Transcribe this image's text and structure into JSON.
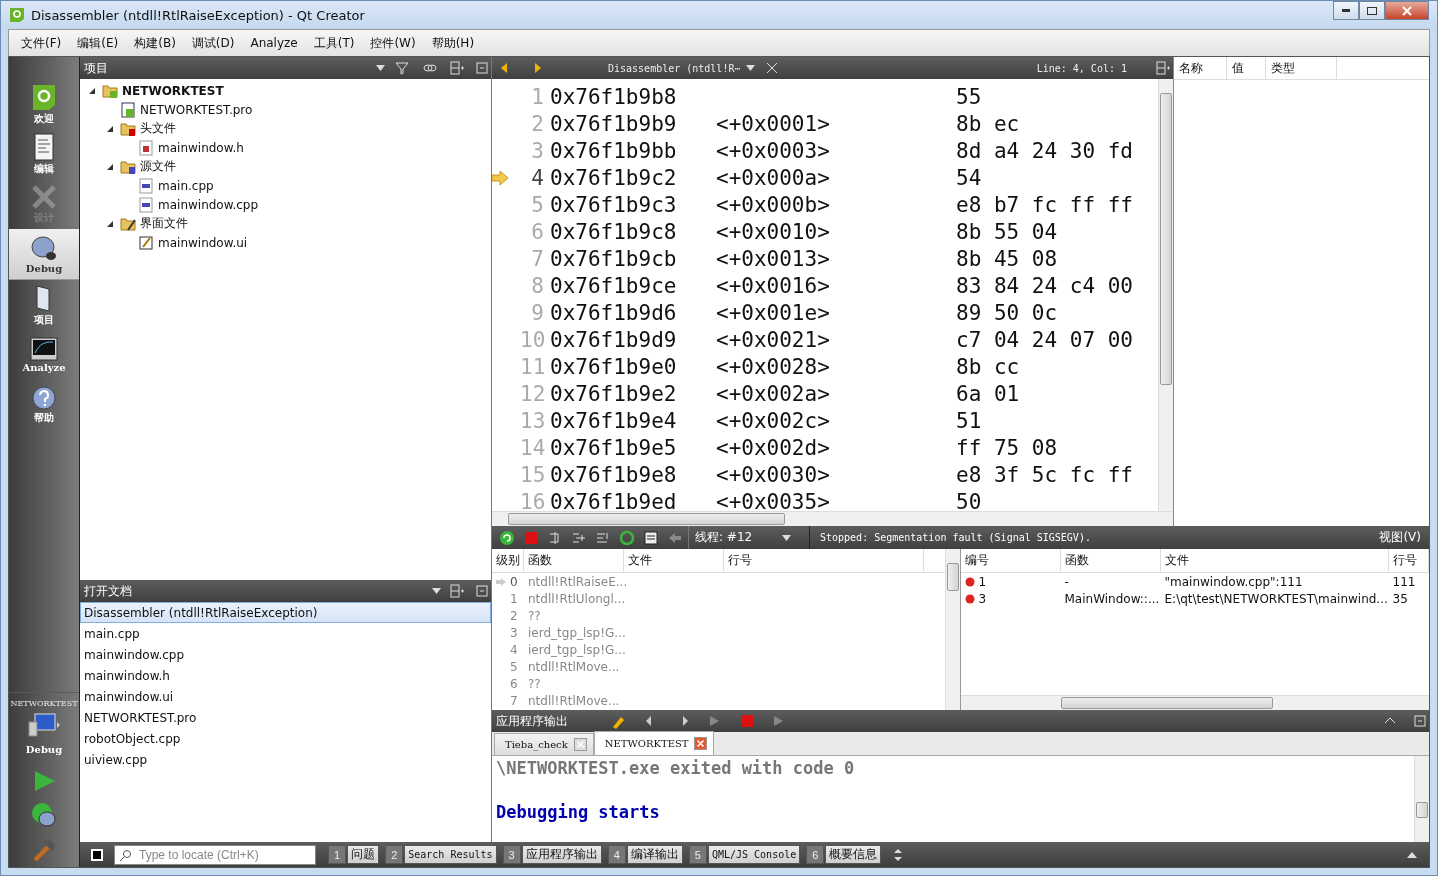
{
  "window": {
    "title": "Disassembler (ntdll!RtlRaiseException) - Qt Creator"
  },
  "menu": [
    "文件(F)",
    "编辑(E)",
    "构建(B)",
    "调试(D)",
    "Analyze",
    "工具(T)",
    "控件(W)",
    "帮助(H)"
  ],
  "modes": [
    {
      "label": "欢迎",
      "selected": false,
      "disabled": false
    },
    {
      "label": "编辑",
      "selected": false,
      "disabled": false
    },
    {
      "label": "设计",
      "selected": false,
      "disabled": true
    },
    {
      "label": "Debug",
      "selected": true,
      "disabled": false
    },
    {
      "label": "项目",
      "selected": false,
      "disabled": false
    },
    {
      "label": "Analyze",
      "selected": false,
      "disabled": false
    },
    {
      "label": "帮助",
      "selected": false,
      "disabled": false
    }
  ],
  "target": {
    "project": "NETWORKTEST",
    "build": "Debug"
  },
  "project_panel": {
    "title": "项目",
    "tree": [
      {
        "label": "NETWORKTEST",
        "kind": "project",
        "expanded": true,
        "children": [
          {
            "label": "NETWORKTEST.pro",
            "kind": "pro"
          },
          {
            "label": "头文件",
            "kind": "header-folder",
            "expanded": true,
            "children": [
              {
                "label": "mainwindow.h",
                "kind": "header"
              }
            ]
          },
          {
            "label": "源文件",
            "kind": "source-folder",
            "expanded": true,
            "children": [
              {
                "label": "main.cpp",
                "kind": "source"
              },
              {
                "label": "mainwindow.cpp",
                "kind": "source"
              }
            ]
          },
          {
            "label": "界面文件",
            "kind": "form-folder",
            "expanded": true,
            "children": [
              {
                "label": "mainwindow.ui",
                "kind": "form"
              }
            ]
          }
        ]
      }
    ]
  },
  "open_documents": {
    "title": "打开文档",
    "items": [
      {
        "label": "Disassembler (ntdll!RtlRaiseException)",
        "selected": true
      },
      {
        "label": "main.cpp",
        "selected": false
      },
      {
        "label": "mainwindow.cpp",
        "selected": false
      },
      {
        "label": "mainwindow.h",
        "selected": false
      },
      {
        "label": "mainwindow.ui",
        "selected": false
      },
      {
        "label": "NETWORKTEST.pro",
        "selected": false
      },
      {
        "label": "robotObject.cpp",
        "selected": false
      },
      {
        "label": "uiview.cpp",
        "selected": false
      }
    ]
  },
  "editor": {
    "document": "Disassembler (ntdll!R⋯",
    "position": "Line: 4, Col: 1",
    "lines": [
      {
        "number": "1",
        "address": "0x76f1b9b8",
        "bytes": "55",
        "current": false
      },
      {
        "number": "2",
        "address": "0x76f1b9b9",
        "offset": "<+0x0001>",
        "bytes": "8b ec",
        "current": false
      },
      {
        "number": "3",
        "address": "0x76f1b9bb",
        "offset": "<+0x0003>",
        "bytes": "8d a4 24 30 fd",
        "current": false
      },
      {
        "number": "4",
        "address": "0x76f1b9c2",
        "offset": "<+0x000a>",
        "bytes": "54",
        "current": true
      },
      {
        "number": "5",
        "address": "0x76f1b9c3",
        "offset": "<+0x000b>",
        "bytes": "e8 b7 fc ff ff",
        "current": false
      },
      {
        "number": "6",
        "address": "0x76f1b9c8",
        "offset": "<+0x0010>",
        "bytes": "8b 55 04",
        "current": false
      },
      {
        "number": "7",
        "address": "0x76f1b9cb",
        "offset": "<+0x0013>",
        "bytes": "8b 45 08",
        "current": false
      },
      {
        "number": "8",
        "address": "0x76f1b9ce",
        "offset": "<+0x0016>",
        "bytes": "83 84 24 c4 00",
        "current": false
      },
      {
        "number": "9",
        "address": "0x76f1b9d6",
        "offset": "<+0x001e>",
        "bytes": "89 50 0c",
        "current": false
      },
      {
        "number": "10",
        "address": "0x76f1b9d9",
        "offset": "<+0x0021>",
        "bytes": "c7 04 24 07 00",
        "current": false
      },
      {
        "number": "11",
        "address": "0x76f1b9e0",
        "offset": "<+0x0028>",
        "bytes": "8b cc",
        "current": false
      },
      {
        "number": "12",
        "address": "0x76f1b9e2",
        "offset": "<+0x002a>",
        "bytes": "6a 01",
        "current": false
      },
      {
        "number": "13",
        "address": "0x76f1b9e4",
        "offset": "<+0x002c>",
        "bytes": "51",
        "current": false
      },
      {
        "number": "14",
        "address": "0x76f1b9e5",
        "offset": "<+0x002d>",
        "bytes": "ff 75 08",
        "current": false
      },
      {
        "number": "15",
        "address": "0x76f1b9e8",
        "offset": "<+0x0030>",
        "bytes": "e8 3f 5c fc ff",
        "current": false
      },
      {
        "number": "16",
        "address": "0x76f1b9ed",
        "offset": "<+0x0035>",
        "bytes": "50",
        "current": false
      }
    ]
  },
  "locals": {
    "columns": [
      "名称",
      "值",
      "类型"
    ]
  },
  "debug_toolbar": {
    "thread": "线程: #12",
    "status": "Stopped: Segmentation fault (Signal SIGSEGV).",
    "view_menu": "视图(V)"
  },
  "stack": {
    "columns": [
      "级别",
      "函数",
      "文件",
      "行号"
    ],
    "rows": [
      {
        "level": "0",
        "function": "ntdll!RtlRaiseE...",
        "current": true
      },
      {
        "level": "1",
        "function": "ntdll!RtlUlongl...",
        "current": false
      },
      {
        "level": "2",
        "function": "??",
        "current": false
      },
      {
        "level": "3",
        "function": "ierd_tgp_lsp!G...",
        "current": false
      },
      {
        "level": "4",
        "function": "ierd_tgp_lsp!G...",
        "current": false
      },
      {
        "level": "5",
        "function": "ntdll!RtlMove...",
        "current": false
      },
      {
        "level": "6",
        "function": "??",
        "current": false
      },
      {
        "level": "7",
        "function": "ntdll!RtlMove...",
        "current": false
      }
    ]
  },
  "breakpoints": {
    "columns": [
      "编号",
      "函数",
      "文件",
      "行号"
    ],
    "rows": [
      {
        "number": "1",
        "function": "-",
        "file": "\"mainwindow.cpp\":111",
        "line": "111"
      },
      {
        "number": "3",
        "function": "MainWindow::...",
        "file": "E:\\qt\\test\\NETWORKTEST\\mainwind...",
        "line": "35"
      }
    ]
  },
  "output": {
    "title": "应用程序输出",
    "tabs": [
      {
        "label": "Tieba_check",
        "selected": false
      },
      {
        "label": "NETWORKTEST",
        "selected": true
      }
    ],
    "lines": [
      {
        "text": "\\NETWORKTEST.exe exited with code 0",
        "kind": "stdout"
      },
      {
        "text": "Debugging starts",
        "kind": "debug"
      }
    ]
  },
  "status_bar": {
    "locate_placeholder": "Type to locate (Ctrl+K)",
    "panes": [
      {
        "number": "1",
        "label": "问题"
      },
      {
        "number": "2",
        "label": "Search Results"
      },
      {
        "number": "3",
        "label": "应用程序输出"
      },
      {
        "number": "4",
        "label": "编译输出"
      },
      {
        "number": "5",
        "label": "QML/JS Console"
      },
      {
        "number": "6",
        "label": "概要信息"
      }
    ]
  }
}
